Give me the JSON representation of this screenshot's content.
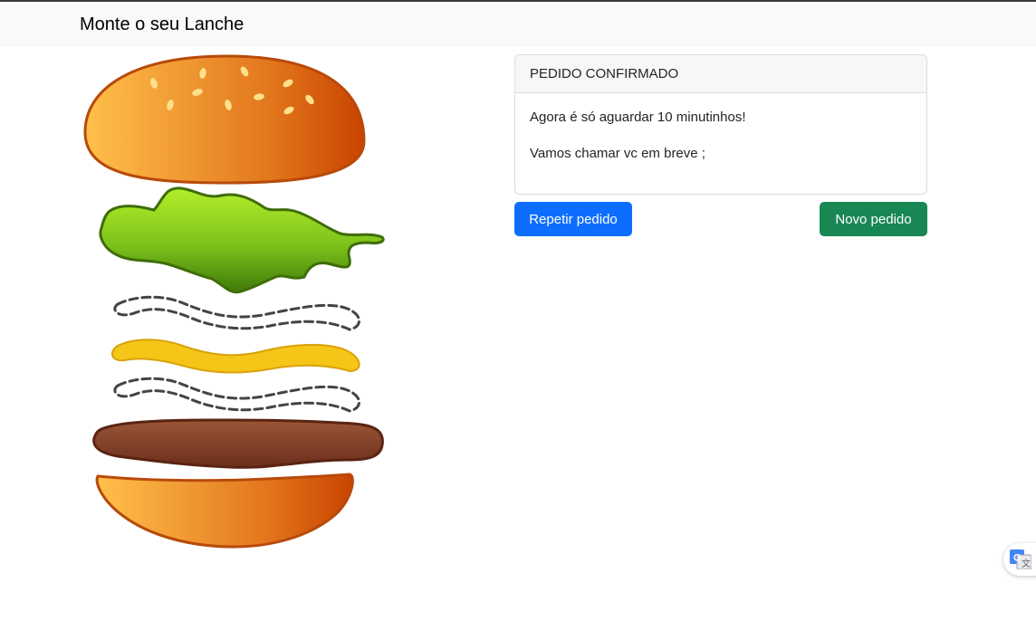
{
  "navbar": {
    "brand": "Monte o seu Lanche"
  },
  "order_card": {
    "header": "PEDIDO CONFIRMADO",
    "line1": "Agora é só aguardar 10 minutinhos!",
    "line2": "Vamos chamar vc em breve ;"
  },
  "actions": {
    "repeat_label": "Repetir pedido",
    "new_label": "Novo pedido"
  },
  "colors": {
    "primary": "#0d6efd",
    "success": "#198754",
    "bun_outline": "#b84a0a",
    "lettuce": "#8dd11a",
    "mustard": "#f5c518",
    "patty": "#7a3b22"
  },
  "icons": {
    "translate": "google-translate-icon"
  }
}
